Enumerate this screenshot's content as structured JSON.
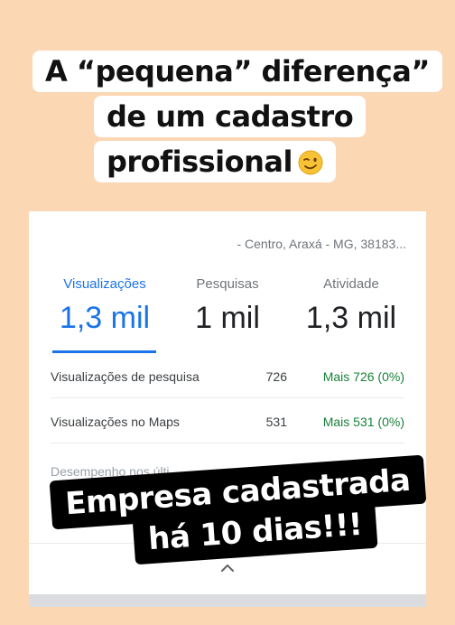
{
  "headline": {
    "line1": "A “pequena” diferença”",
    "line2": "de um cadastro",
    "line3": "profissional",
    "emoji_icon": "winking-face-icon"
  },
  "card": {
    "address": "- Centro, Araxá - MG, 38183...",
    "tabs": [
      {
        "label": "Visualizações",
        "value": "1,3 mil",
        "active": true
      },
      {
        "label": "Pesquisas",
        "value": "1 mil",
        "active": false
      },
      {
        "label": "Atividade",
        "value": "1,3 mil",
        "active": false
      }
    ],
    "rows": [
      {
        "label": "Visualizações de pesquisa",
        "value": "726",
        "delta": "Mais 726 (0%)"
      },
      {
        "label": "Visualizações no Maps",
        "value": "531",
        "delta": "Mais 531 (0%)"
      }
    ],
    "performance_label": "Desempenho nos últi",
    "expand_icon": "chevron-up-icon"
  },
  "sticker": {
    "line1": "Empresa cadastrada",
    "line2": "há 10 dias!!!"
  },
  "colors": {
    "background": "#fbd7b4",
    "accent": "#1a73e8",
    "positive": "#188038"
  }
}
